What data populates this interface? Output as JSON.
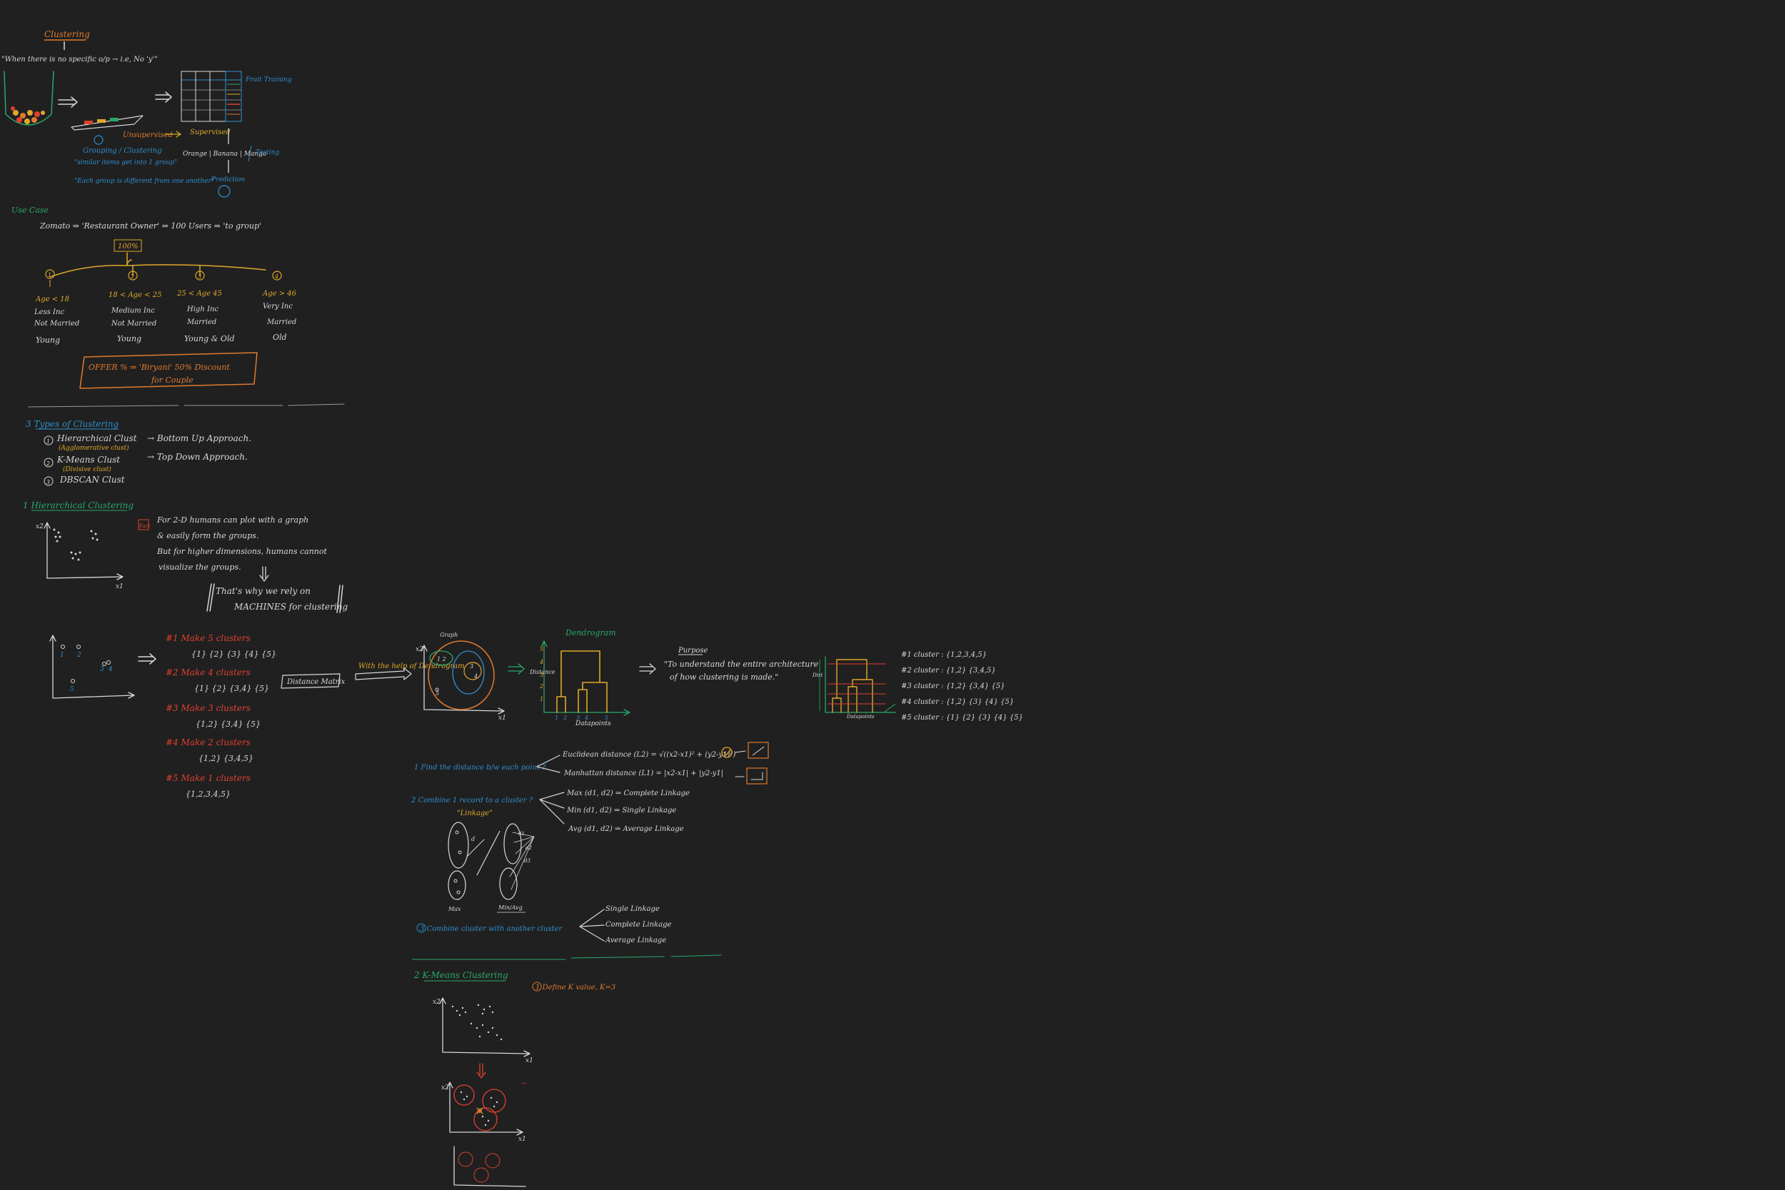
{
  "colors": {
    "background": "#202020",
    "white": "#d8d8d8",
    "orange": "#e07a2e",
    "yellow": "#e0a82a",
    "blue": "#2f8fd0",
    "green": "#2aa86a",
    "red": "#e0402e"
  },
  "intro": {
    "title": "Clustering",
    "note": "\"When there is no specific o/p → i.e, No 'y'\"",
    "unsupervised": "Unsupervised",
    "supervised": "Supervised",
    "grouping": "Grouping / Clustering",
    "similar": "\"similar items get into 1 group\"",
    "different": "\"Each group is different from one another\"",
    "output_classes": "Orange | Banana | Mango",
    "testing": "Testing",
    "prediction": "Prediction",
    "table_label": "Fruit Training"
  },
  "usecase": {
    "heading": "Use Case",
    "line": "Zomato ⇒ 'Restaurant Owner' ⇒ 100 Users ⇒ 'to group'",
    "total": "100%",
    "groups": [
      {
        "num": "1",
        "age": "Age < 18",
        "income": "Less Inc",
        "status": "Not Married",
        "label": "Young"
      },
      {
        "num": "2",
        "age": "18 < Age < 25",
        "income": "Medium Inc",
        "status": "Not Married",
        "label": "Young"
      },
      {
        "num": "3",
        "age": "25 < Age 45",
        "income": "High Inc",
        "status": "Married",
        "label": "Young & Old"
      },
      {
        "num": "4",
        "age": "Age > 46",
        "income": "Very Inc",
        "status": "Married",
        "label": "Old"
      }
    ],
    "offer_line1": "OFFER % ⇒ 'Biryani' 50% Discount",
    "offer_line2": "for Couple"
  },
  "types": {
    "heading": "3 Types of Clustering",
    "items": [
      {
        "num": "1",
        "name": "Hierarchical Clust",
        "sub": "(Agglomerative clust)",
        "approach": "→ Bottom Up Approach."
      },
      {
        "num": "2",
        "name": "K-Means Clust",
        "sub": "(Divisive clust)",
        "approach": "→ Top Down Approach."
      },
      {
        "num": "3",
        "name": "DBSCAN Clust",
        "sub": "",
        "approach": ""
      }
    ]
  },
  "hierarchical": {
    "heading": "1 Hierarchical Clustering",
    "fact_tag": "Fact",
    "lines": [
      "For 2-D humans can plot with a graph",
      "& easily form the groups.",
      "But for higher dimensions, humans cannot",
      "visualize the groups."
    ],
    "conclusion1": "That's why we rely on",
    "conclusion2": "MACHINES for clustering",
    "steps": [
      {
        "title": "#1 Make 5 clusters",
        "value": "{1} {2} {3} {4} {5}"
      },
      {
        "title": "#2 Make 4 clusters",
        "value": "{1} {2} {3,4} {5}"
      },
      {
        "title": "#3 Make 3 clusters",
        "value": "{1,2} {3,4} {5}"
      },
      {
        "title": "#4 Make 2 clusters",
        "value": "{1,2} {3,4,5}"
      },
      {
        "title": "#5 Make 1 clusters",
        "value": "{1,2,3,4,5}"
      }
    ],
    "distance_matrix": "Distance Matrix",
    "with_help": "With the help of Dendrogram",
    "dendrogram": "Dendrogram",
    "datapoints": "Datapoints",
    "distance": "Distance",
    "purpose_title": "Purpose",
    "purpose1": "\"To understand the entire architecture",
    "purpose2": "of how clustering is made.\"",
    "cluster_list": [
      "#1 cluster : {1,2,3,4,5}",
      "#2 cluster : {1,2} {3,4,5}",
      "#3 cluster : {1,2} {3,4} {5}",
      "#4 cluster : {1,2} {3} {4} {5}",
      "#5 cluster : {1} {2} {3} {4} {5}"
    ]
  },
  "distance_section": {
    "step1": "1 Find the distance b/w each point ?",
    "euclid": "Euclidean distance (L2) = √((x2-x1)² + (y2-y1)²)",
    "manhattan": "Manhattan distance (L1) = |x2-x1| + |y2-y1|",
    "step2": "2 Combine 1 record to a cluster ?",
    "linkage_word": "\"Linkage\"",
    "max": "Max (d1, d2) ⇒ Complete Linkage",
    "min": "Min (d1, d2) ⇒ Single Linkage",
    "avg": "Avg (d1, d2) ⇒ Average Linkage",
    "max_label": "Max",
    "min_label": "Min/Avg",
    "step3": "3 Combine cluster with another cluster",
    "single": "Single Linkage",
    "complete": "Complete Linkage",
    "average": "Average Linkage"
  },
  "kmeans": {
    "heading": "2 K-Means Clustering",
    "step1": "1 Define K value, K=3"
  }
}
